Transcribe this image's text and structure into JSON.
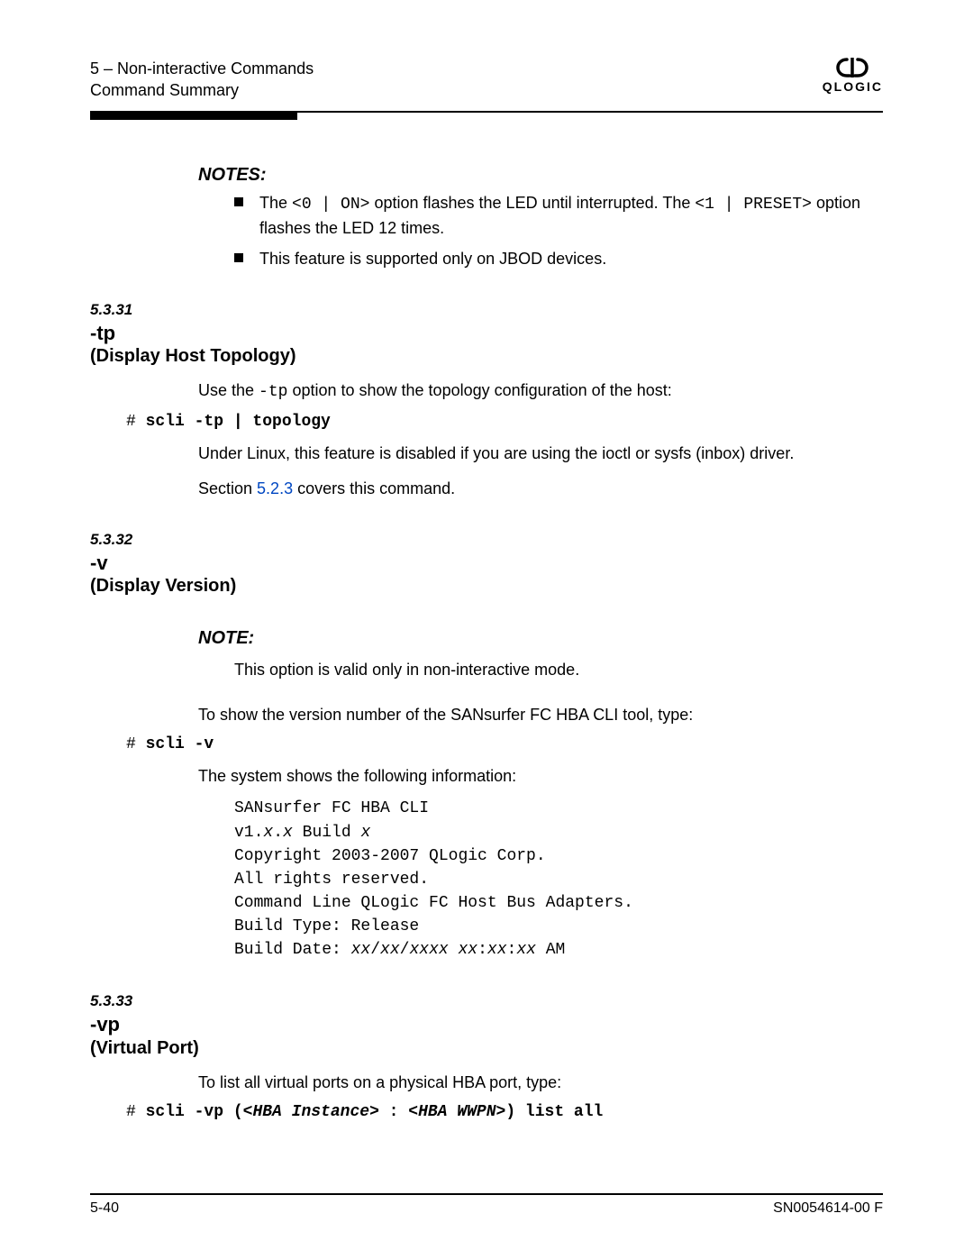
{
  "header": {
    "line1": "5 – Non-interactive Commands",
    "line2": "Command Summary",
    "brand": "QLOGIC"
  },
  "notes_multi": {
    "title": "NOTES:",
    "item1_pre": "The ",
    "item1_code1": "<0 | ON>",
    "item1_mid": " option flashes the LED until interrupted. The ",
    "item1_code2": "<1 | PRESET>",
    "item1_post": " option flashes the LED 12 times.",
    "item2": "This feature is supported only on JBOD devices."
  },
  "sec31": {
    "num": "5.3.31",
    "flag": "-tp",
    "subtitle": "(Display Host Topology)",
    "p1_a": "Use the ",
    "p1_code": "-tp",
    "p1_b": " option to show the topology configuration of the host:",
    "cmd_prompt": "# ",
    "cmd": "scli -tp | topology",
    "p2": "Under Linux, this feature is disabled if you are using the ioctl or sysfs (inbox) driver.",
    "p3_a": "Section ",
    "p3_link": "5.2.3",
    "p3_b": " covers this command."
  },
  "sec32": {
    "num": "5.3.32",
    "flag": "-v",
    "subtitle": "(Display Version)",
    "note_title": "NOTE:",
    "note_text": "This option is valid only in non-interactive mode.",
    "p1": "To show the version number of the SANsurfer FC HBA CLI tool, type:",
    "cmd_prompt": "# ",
    "cmd": "scli -v",
    "p2": "The system shows the following information:",
    "out_l1": "SANsurfer FC HBA CLI",
    "out_l2a": "v1.",
    "out_l2b": "x",
    "out_l2c": ".",
    "out_l2d": "x",
    "out_l2e": " Build ",
    "out_l2f": "x",
    "out_l3": "Copyright 2003-2007 QLogic Corp.",
    "out_l4": "All rights reserved.",
    "out_l5": "Command Line QLogic FC Host Bus Adapters.",
    "out_l6": "Build Type: Release",
    "out_l7a": "Build Date: ",
    "out_l7b": "xx",
    "out_l7c": "/",
    "out_l7d": "xx",
    "out_l7e": "/",
    "out_l7f": "xxxx",
    "out_l7g": " ",
    "out_l7h": "xx",
    "out_l7i": ":",
    "out_l7j": "xx",
    "out_l7k": ":",
    "out_l7l": "xx",
    "out_l7m": " AM"
  },
  "sec33": {
    "num": "5.3.33",
    "flag": "-vp",
    "subtitle": "(Virtual Port)",
    "p1": "To list all virtual ports on a physical HBA port, type:",
    "cmd_prompt": "# ",
    "cmd_a": "scli -vp (",
    "cmd_b": "<HBA Instance>",
    "cmd_c": " : ",
    "cmd_d": "<HBA WWPN>",
    "cmd_e": ") list all"
  },
  "footer": {
    "left": "5-40",
    "right": "SN0054614-00  F"
  }
}
